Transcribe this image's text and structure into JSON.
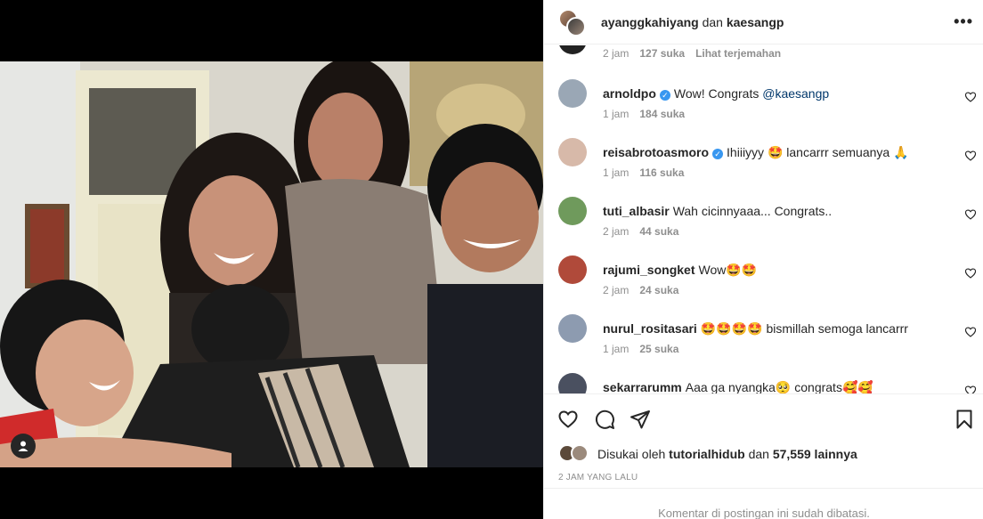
{
  "post_header": {
    "user1": "ayanggkahiyang",
    "joiner": "dan",
    "user2": "kaesangp",
    "more_label": "•••"
  },
  "first_comment_meta": {
    "time": "2 jam",
    "likes": "127 suka",
    "translate": "Lihat terjemahan"
  },
  "comments": [
    {
      "user": "arnoldpo",
      "verified": true,
      "text": "Wow! Congrats ",
      "mention": "@kaesangp",
      "time": "1 jam",
      "likes": "184 suka",
      "avatar_color": "#9aa7b5"
    },
    {
      "user": "reisabrotoasmoro",
      "verified": true,
      "text": "Ihiiiyyy 🤩 lancarrr semuanya 🙏",
      "mention": "",
      "time": "1 jam",
      "likes": "116 suka",
      "avatar_color": "#d7b9a9"
    },
    {
      "user": "tuti_albasir",
      "verified": false,
      "text": "Wah cicinnyaaa... Congrats..",
      "mention": "",
      "time": "2 jam",
      "likes": "44 suka",
      "avatar_color": "#6f9a5c"
    },
    {
      "user": "rajumi_songket",
      "verified": false,
      "text": "Wow🤩🤩",
      "mention": "",
      "time": "2 jam",
      "likes": "24 suka",
      "avatar_color": "#b04a3a"
    },
    {
      "user": "nurul_rositasari",
      "verified": false,
      "text": "🤩🤩🤩🤩 bismillah semoga lancarrr",
      "mention": "",
      "time": "1 jam",
      "likes": "25 suka",
      "avatar_color": "#8d9bb0"
    },
    {
      "user": "sekarrarumm",
      "verified": false,
      "text": "Aaa ga nyangka🥺 congrats🥰🥰",
      "mention": "",
      "time": "",
      "likes": "",
      "avatar_color": "#4a5060"
    }
  ],
  "likes": {
    "prefix": "Disukai oleh",
    "user": "tutorialhidub",
    "joiner": "dan",
    "count": "57,559 lainnya"
  },
  "timestamp": "2 JAM YANG LALU",
  "comments_limited": "Komentar di postingan ini sudah dibatasi.",
  "icons": [
    "heart-icon",
    "comment-icon",
    "share-icon",
    "bookmark-icon",
    "more-icon",
    "user-tag-icon",
    "verified-icon"
  ],
  "colors": {
    "verified": "#3897f0",
    "mention": "#00376b",
    "muted": "#8e8e8e",
    "text": "#262626"
  }
}
